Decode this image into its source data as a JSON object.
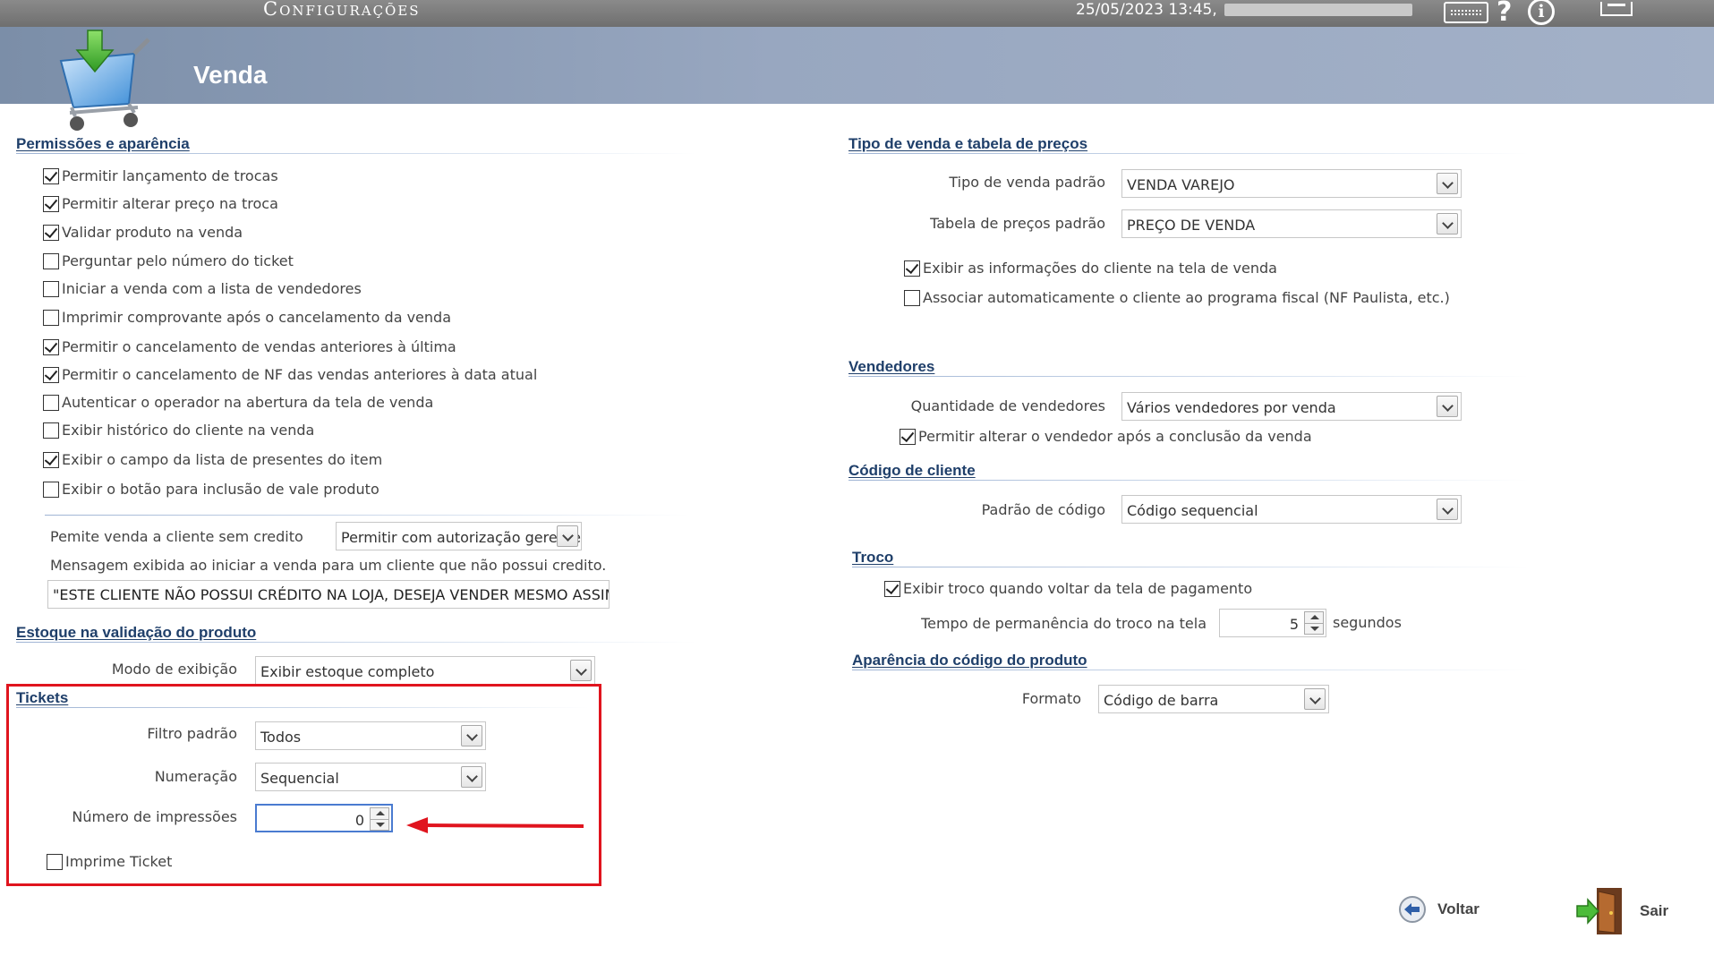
{
  "topbar": {
    "app_title": "Configurações",
    "datetime": "25/05/2023 13:45,",
    "keyboard_icon": "keyboard-icon",
    "help_icon": "help-icon",
    "help_glyph": "?",
    "info_icon": "info-icon",
    "info_glyph": "i",
    "minimize_icon": "minimize-icon"
  },
  "header": {
    "title": "Venda",
    "icon": "shopping-cart-icon"
  },
  "permissoes": {
    "title": "Permissões e aparência",
    "items": [
      {
        "label": "Permitir lançamento de trocas",
        "checked": true
      },
      {
        "label": "Permitir alterar preço na troca",
        "checked": true
      },
      {
        "label": "Validar produto na venda",
        "checked": true
      },
      {
        "label": "Perguntar pelo número do ticket",
        "checked": false
      },
      {
        "label": "Iniciar a venda com a lista de vendedores",
        "checked": false
      },
      {
        "label": "Imprimir comprovante após o cancelamento da venda",
        "checked": false
      },
      {
        "label": "Permitir o cancelamento de vendas anteriores à última",
        "checked": true
      },
      {
        "label": "Permitir o cancelamento de NF das vendas anteriores à data atual",
        "checked": true
      },
      {
        "label": "Autenticar o operador na abertura da tela de venda",
        "checked": false
      },
      {
        "label": "Exibir histórico do cliente na venda",
        "checked": false
      },
      {
        "label": "Exibir o campo da lista de presentes do item",
        "checked": true
      },
      {
        "label": "Exibir o botão para inclusão de vale produto",
        "checked": false
      }
    ],
    "credit_label": "Pemite venda a cliente sem credito",
    "credit_value": "Permitir com autorização gerente",
    "message_label": "Mensagem exibida ao iniciar a venda para um cliente que não possui credito.",
    "message_value": "\"ESTE CLIENTE NÃO POSSUI CRÉDITO NA LOJA, DESEJA VENDER MESMO ASSIM ?\""
  },
  "estoque": {
    "title": "Estoque na validação do produto",
    "mode_label": "Modo de exibição",
    "mode_value": "Exibir estoque completo"
  },
  "tickets": {
    "title": "Tickets",
    "filter_label": "Filtro padrão",
    "filter_value": "Todos",
    "numbering_label": "Numeração",
    "numbering_value": "Sequencial",
    "prints_label": "Número de impressões",
    "prints_value": "0",
    "print_ticket_label": "Imprime Ticket",
    "print_ticket_checked": false
  },
  "tipo_venda": {
    "title": "Tipo de venda e tabela de preços",
    "sale_type_label": "Tipo de venda padrão",
    "sale_type_value": "VENDA VAREJO",
    "price_table_label": "Tabela de preços padrão",
    "price_table_value": "PREÇO DE VENDA",
    "show_client_info_label": "Exibir as informações do cliente na tela de venda",
    "show_client_info_checked": true,
    "fiscal_program_label": "Associar automaticamente o cliente ao programa fiscal (NF Paulista, etc.)",
    "fiscal_program_checked": false
  },
  "vendedores": {
    "title": "Vendedores",
    "qty_label": "Quantidade de vendedores",
    "qty_value": "Vários vendedores por venda",
    "change_label": "Permitir alterar o vendedor após a conclusão da venda",
    "change_checked": true
  },
  "codigo_cliente": {
    "title": "Código de cliente",
    "pattern_label": "Padrão de código",
    "pattern_value": "Código sequencial"
  },
  "troco": {
    "title": "Troco",
    "show_change_label": "Exibir troco quando voltar da tela de pagamento",
    "show_change_checked": true,
    "time_label": "Tempo de permanência do troco na tela",
    "time_value": "5",
    "time_unit": "segundos"
  },
  "aparencia_codigo": {
    "title": "Aparência do código do produto",
    "format_label": "Formato",
    "format_value": "Código de barra"
  },
  "actions": {
    "back_label": "Voltar",
    "back_icon": "back-arrow-icon",
    "exit_label": "Sair",
    "exit_icon": "exit-door-icon"
  },
  "colors": {
    "highlight_border": "#e0141e",
    "section_title": "#1f3f6a",
    "header_band": "#98a7c0"
  }
}
